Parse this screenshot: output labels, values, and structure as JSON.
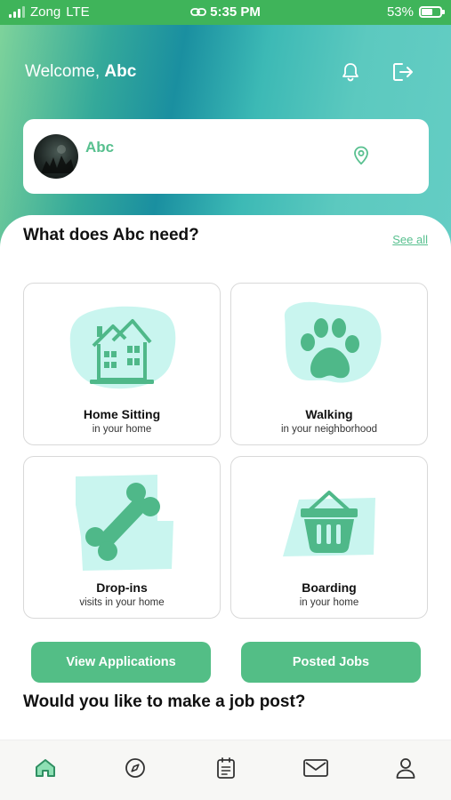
{
  "status_bar": {
    "carrier": "Zong",
    "network": "LTE",
    "time": "5:35 PM",
    "battery": "53%"
  },
  "header": {
    "welcome_prefix": "Welcome,",
    "user_name": "Abc",
    "bell_icon": "bell-icon",
    "logout_icon": "logout-icon"
  },
  "profile": {
    "name": "Abc",
    "location_icon": "map-pin-icon"
  },
  "services": {
    "title": "What does Abc need?",
    "see_all": "See all",
    "items": [
      {
        "title": "Home Sitting",
        "subtitle": "in your home",
        "icon": "house-icon"
      },
      {
        "title": "Walking",
        "subtitle": "in your neighborhood",
        "icon": "paw-icon"
      },
      {
        "title": "Drop-ins",
        "subtitle": "visits in your home",
        "icon": "bone-icon"
      },
      {
        "title": "Boarding",
        "subtitle": "in your home",
        "icon": "basket-icon"
      }
    ]
  },
  "actions": {
    "view_applications": "View Applications",
    "posted_jobs": "Posted Jobs"
  },
  "job_post": {
    "title": "Would you like to make a job post?"
  },
  "tabs": [
    {
      "name": "home-tab",
      "icon": "home-icon",
      "active": true
    },
    {
      "name": "explore-tab",
      "icon": "compass-icon",
      "active": false
    },
    {
      "name": "jobs-tab",
      "icon": "clipboard-icon",
      "active": false
    },
    {
      "name": "messages-tab",
      "icon": "mail-icon",
      "active": false
    },
    {
      "name": "profile-tab",
      "icon": "user-icon",
      "active": false
    }
  ],
  "colors": {
    "accent": "#53be86",
    "status_bar": "#3fb45a",
    "illustration_bg": "#c9f5ef"
  }
}
